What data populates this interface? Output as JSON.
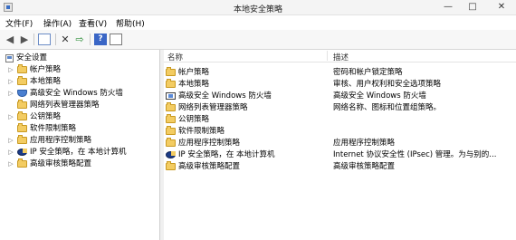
{
  "window": {
    "title": "本地安全策略",
    "minimize": "—",
    "maximize": "□",
    "close": "✕"
  },
  "menu": [
    {
      "label": "文件(F)"
    },
    {
      "label": "操作(A)"
    },
    {
      "label": "查看(V)"
    },
    {
      "label": "帮助(H)"
    }
  ],
  "toolbar": {
    "back": "◀",
    "forward": "▶",
    "delete": "✕",
    "export": "⇨",
    "help": "?"
  },
  "tree": {
    "root": "安全设置",
    "items": [
      {
        "label": "帐户策略",
        "icon": "folder-icon",
        "expandable": true
      },
      {
        "label": "本地策略",
        "icon": "folder-icon",
        "expandable": true
      },
      {
        "label": "高级安全 Windows 防火墙",
        "icon": "shield-icon",
        "expandable": true
      },
      {
        "label": "网络列表管理器策略",
        "icon": "folder-icon",
        "expandable": false
      },
      {
        "label": "公钥策略",
        "icon": "folder-icon",
        "expandable": true
      },
      {
        "label": "软件限制策略",
        "icon": "folder-icon",
        "expandable": false
      },
      {
        "label": "应用程序控制策略",
        "icon": "folder-icon",
        "expandable": true
      },
      {
        "label": "IP 安全策略，在 本地计算机",
        "icon": "ipsec-icon",
        "expandable": true
      },
      {
        "label": "高级审核策略配置",
        "icon": "folder-icon",
        "expandable": true
      }
    ]
  },
  "list": {
    "columns": [
      "名称",
      "描述"
    ],
    "rows": [
      {
        "name": "帐户策略",
        "desc": "密码和帐户锁定策略",
        "icon": "folder-icon"
      },
      {
        "name": "本地策略",
        "desc": "审核、用户权利和安全选项策略",
        "icon": "folder-icon"
      },
      {
        "name": "高级安全 Windows 防火墙",
        "desc": "高级安全 Windows 防火墙",
        "icon": "shield-icon"
      },
      {
        "name": "网络列表管理器策略",
        "desc": "网络名称、图标和位置组策略。",
        "icon": "folder-icon"
      },
      {
        "name": "公钥策略",
        "desc": "",
        "icon": "folder-icon"
      },
      {
        "name": "软件限制策略",
        "desc": "",
        "icon": "folder-icon"
      },
      {
        "name": "应用程序控制策略",
        "desc": "应用程序控制策略",
        "icon": "folder-icon"
      },
      {
        "name": "IP 安全策略，在 本地计算机",
        "desc": "Internet 协议安全性 (IPsec) 管理。为与别的...",
        "icon": "ipsec-icon"
      },
      {
        "name": "高级审核策略配置",
        "desc": "高级审核策略配置",
        "icon": "folder-icon"
      }
    ]
  }
}
